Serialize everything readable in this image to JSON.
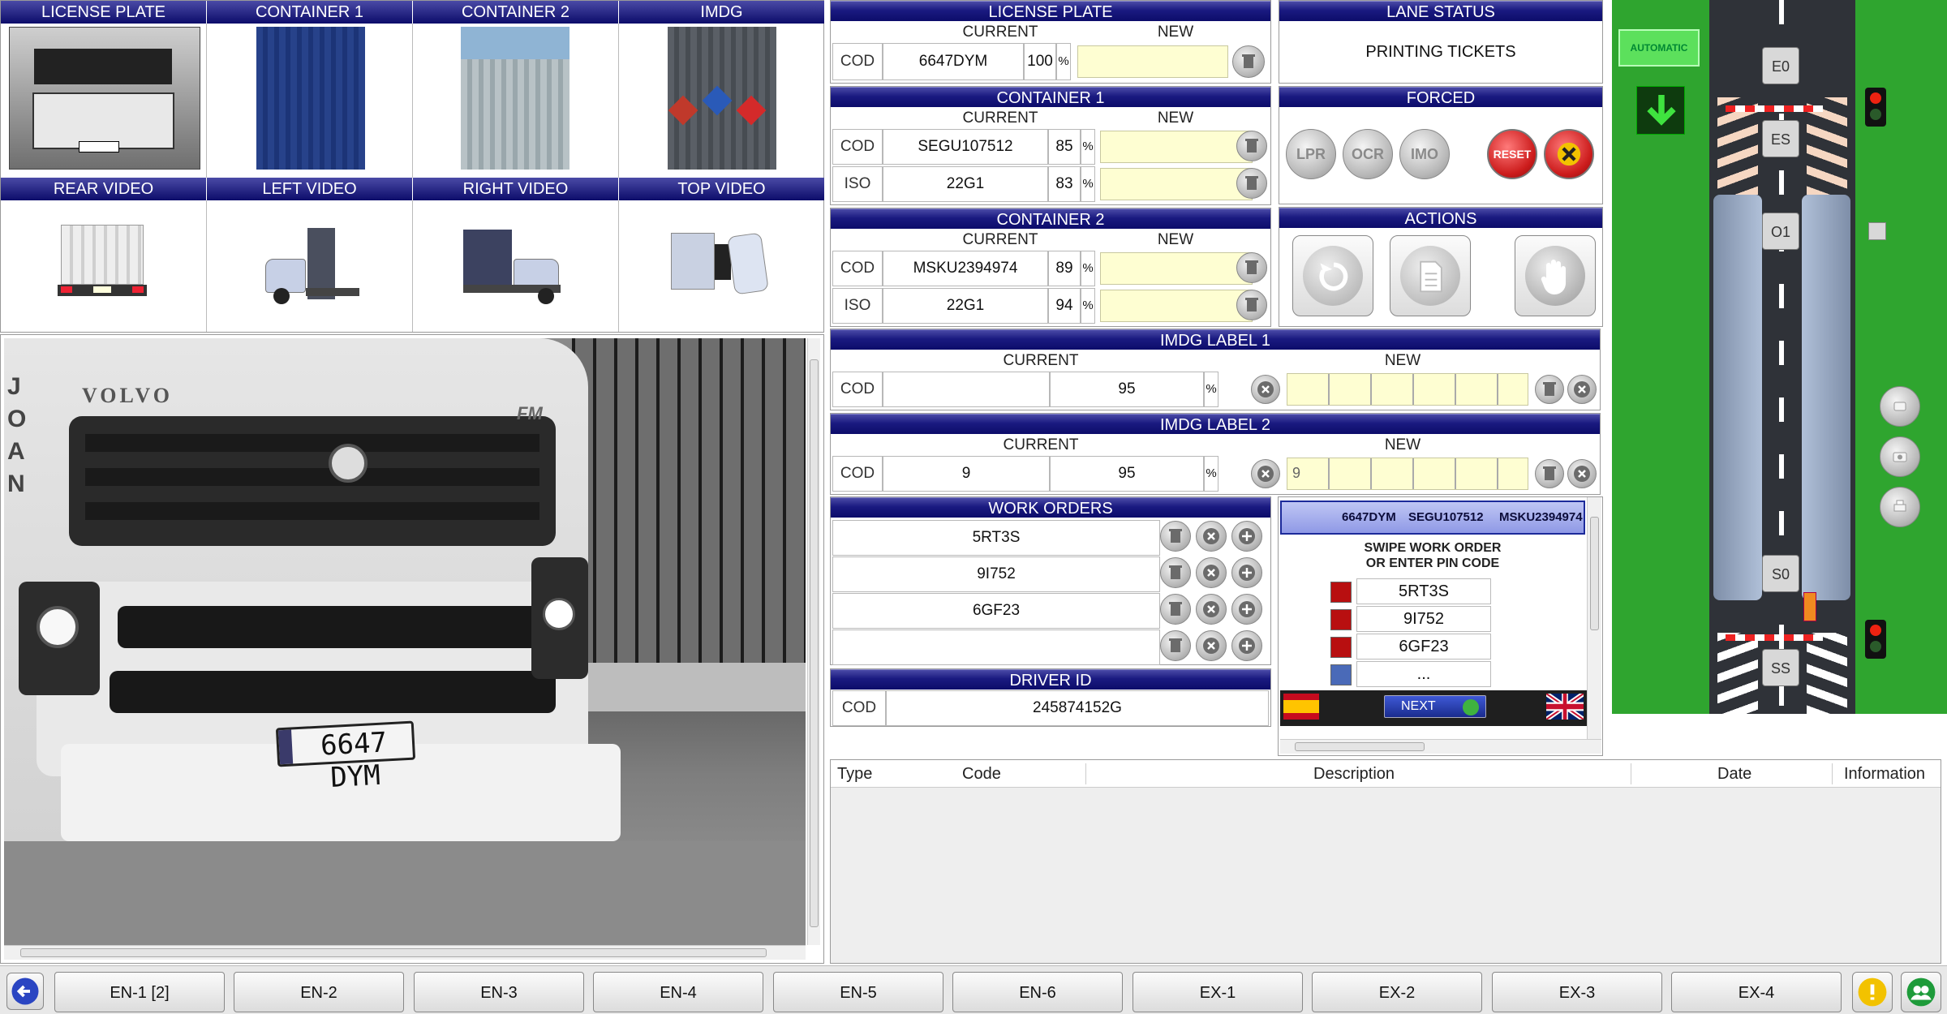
{
  "thumbs": {
    "top": [
      "LICENSE PLATE",
      "CONTAINER 1",
      "CONTAINER 2",
      "IMDG"
    ],
    "bottom": [
      "REAR VIDEO",
      "LEFT VIDEO",
      "RIGHT VIDEO",
      "TOP VIDEO"
    ]
  },
  "camera": {
    "plate_text": "6647 DYM",
    "brand_text": "VOLVO",
    "model_text": "FM",
    "side_text": "JOAN"
  },
  "license_plate": {
    "title": "LICENSE PLATE",
    "current_label": "CURRENT",
    "new_label": "NEW",
    "cod_label": "COD",
    "value": "6647DYM",
    "confidence": "100",
    "pct": "%"
  },
  "container1": {
    "title": "CONTAINER 1",
    "current_label": "CURRENT",
    "new_label": "NEW",
    "rows": [
      {
        "label": "COD",
        "value": "SEGU107512",
        "confidence": "85",
        "pct": "%"
      },
      {
        "label": "ISO",
        "value": "22G1",
        "confidence": "83",
        "pct": "%"
      }
    ]
  },
  "container2": {
    "title": "CONTAINER 2",
    "current_label": "CURRENT",
    "new_label": "NEW",
    "rows": [
      {
        "label": "COD",
        "value": "MSKU2394974",
        "confidence": "89",
        "pct": "%"
      },
      {
        "label": "ISO",
        "value": "22G1",
        "confidence": "94",
        "pct": "%"
      }
    ]
  },
  "imdg1": {
    "title": "IMDG LABEL 1",
    "current_label": "CURRENT",
    "new_label": "NEW",
    "cod_label": "COD",
    "value": "",
    "confidence": "95",
    "pct": "%",
    "new_value": ""
  },
  "imdg2": {
    "title": "IMDG LABEL 2",
    "current_label": "CURRENT",
    "new_label": "NEW",
    "cod_label": "COD",
    "value": "9",
    "confidence": "95",
    "pct": "%",
    "new_value": "9"
  },
  "work_orders": {
    "title": "WORK ORDERS",
    "items": [
      "5RT3S",
      "9I752",
      "6GF23",
      ""
    ]
  },
  "driver": {
    "title": "DRIVER ID",
    "cod_label": "COD",
    "value": "245874152G"
  },
  "lane_status": {
    "title": "LANE STATUS",
    "value": "PRINTING TICKETS"
  },
  "forced": {
    "title": "FORCED",
    "buttons": [
      "LPR",
      "OCR",
      "IMO",
      "RESET"
    ]
  },
  "actions": {
    "title": "ACTIONS"
  },
  "kiosk": {
    "summary_plate": "6647DYM",
    "summary_c1": "SEGU107512",
    "summary_c2": "MSKU2394974",
    "instruction_line1": "SWIPE WORK ORDER",
    "instruction_line2": "OR ENTER PIN CODE",
    "items": [
      "5RT3S",
      "9I752",
      "6GF23",
      "..."
    ],
    "next_label": "NEXT"
  },
  "lane": {
    "mode": "AUTOMATIC",
    "stations": [
      "E0",
      "ES",
      "O1",
      "S0",
      "SS"
    ]
  },
  "events_table": {
    "columns": [
      "Type",
      "Code",
      "Description",
      "Date",
      "Information"
    ]
  },
  "footer": {
    "tabs": [
      "EN-1 [2]",
      "EN-2",
      "EN-3",
      "EN-4",
      "EN-5",
      "EN-6",
      "EX-1",
      "EX-2",
      "EX-3",
      "EX-4"
    ]
  },
  "colors": {
    "header_blue": "#0c0c6a",
    "new_field": "#fefed2",
    "lane_green": "#2bb52b",
    "reset_red": "#cc1c1c"
  }
}
